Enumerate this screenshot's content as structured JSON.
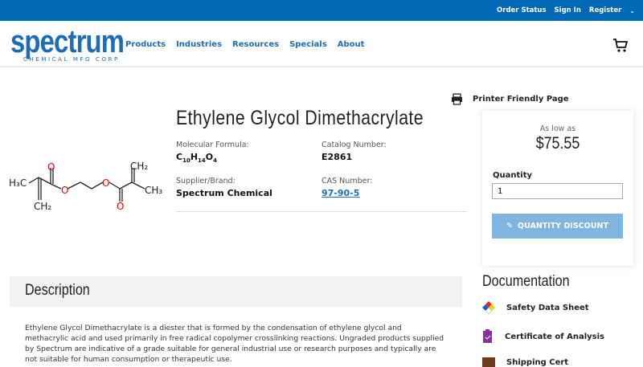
{
  "topbar": {
    "links": [
      "Order Status",
      "Sign In",
      "Register"
    ]
  },
  "logo": {
    "name": "spectrum",
    "tagline": "CHEMICAL MFG CORP"
  },
  "nav": [
    "Products",
    "Industries",
    "Resources",
    "Specials",
    "About"
  ],
  "product": {
    "title": "Ethylene Glycol Dimethacrylate",
    "formula_label": "Molecular Formula:",
    "formula": {
      "c": "C",
      "c_n": "10",
      "h": "H",
      "h_n": "14",
      "o": "O",
      "o_n": "4"
    },
    "catalog_label": "Catalog Number:",
    "catalog": "E2861",
    "supplier_label": "Supplier/Brand:",
    "supplier": "Spectrum Chemical",
    "cas_label": "CAS Number:",
    "cas": "97-90-5"
  },
  "printer": "Printer Friendly Page",
  "pricing": {
    "as_low_as": "As low as",
    "price": "$75.55",
    "quantity_label": "Quantity",
    "quantity": "1",
    "discount_button": "QUANTITY DISCOUNT"
  },
  "description": {
    "heading": "Description",
    "text": "Ethylene Glycol Dimethacrylate is a diester that is formed by the condensation of ethylene glycol and methacrylic acid and used primarily in free radical copolymer crosslinking reactions. Ungraded products supplied by Spectrum are indicative of a grade suitable for general industrial use or research purposes and typically are not suitable for human consumption or therapeutic use."
  },
  "documentation": {
    "heading": "Documentation",
    "items": [
      "Safety Data Sheet",
      "Certificate of Analysis",
      "Shipping Cert"
    ]
  },
  "molecule": {
    "labels": [
      "H₃C",
      "CH₂",
      "O",
      "O",
      "O",
      "O",
      "CH₂",
      "CH₃"
    ]
  }
}
